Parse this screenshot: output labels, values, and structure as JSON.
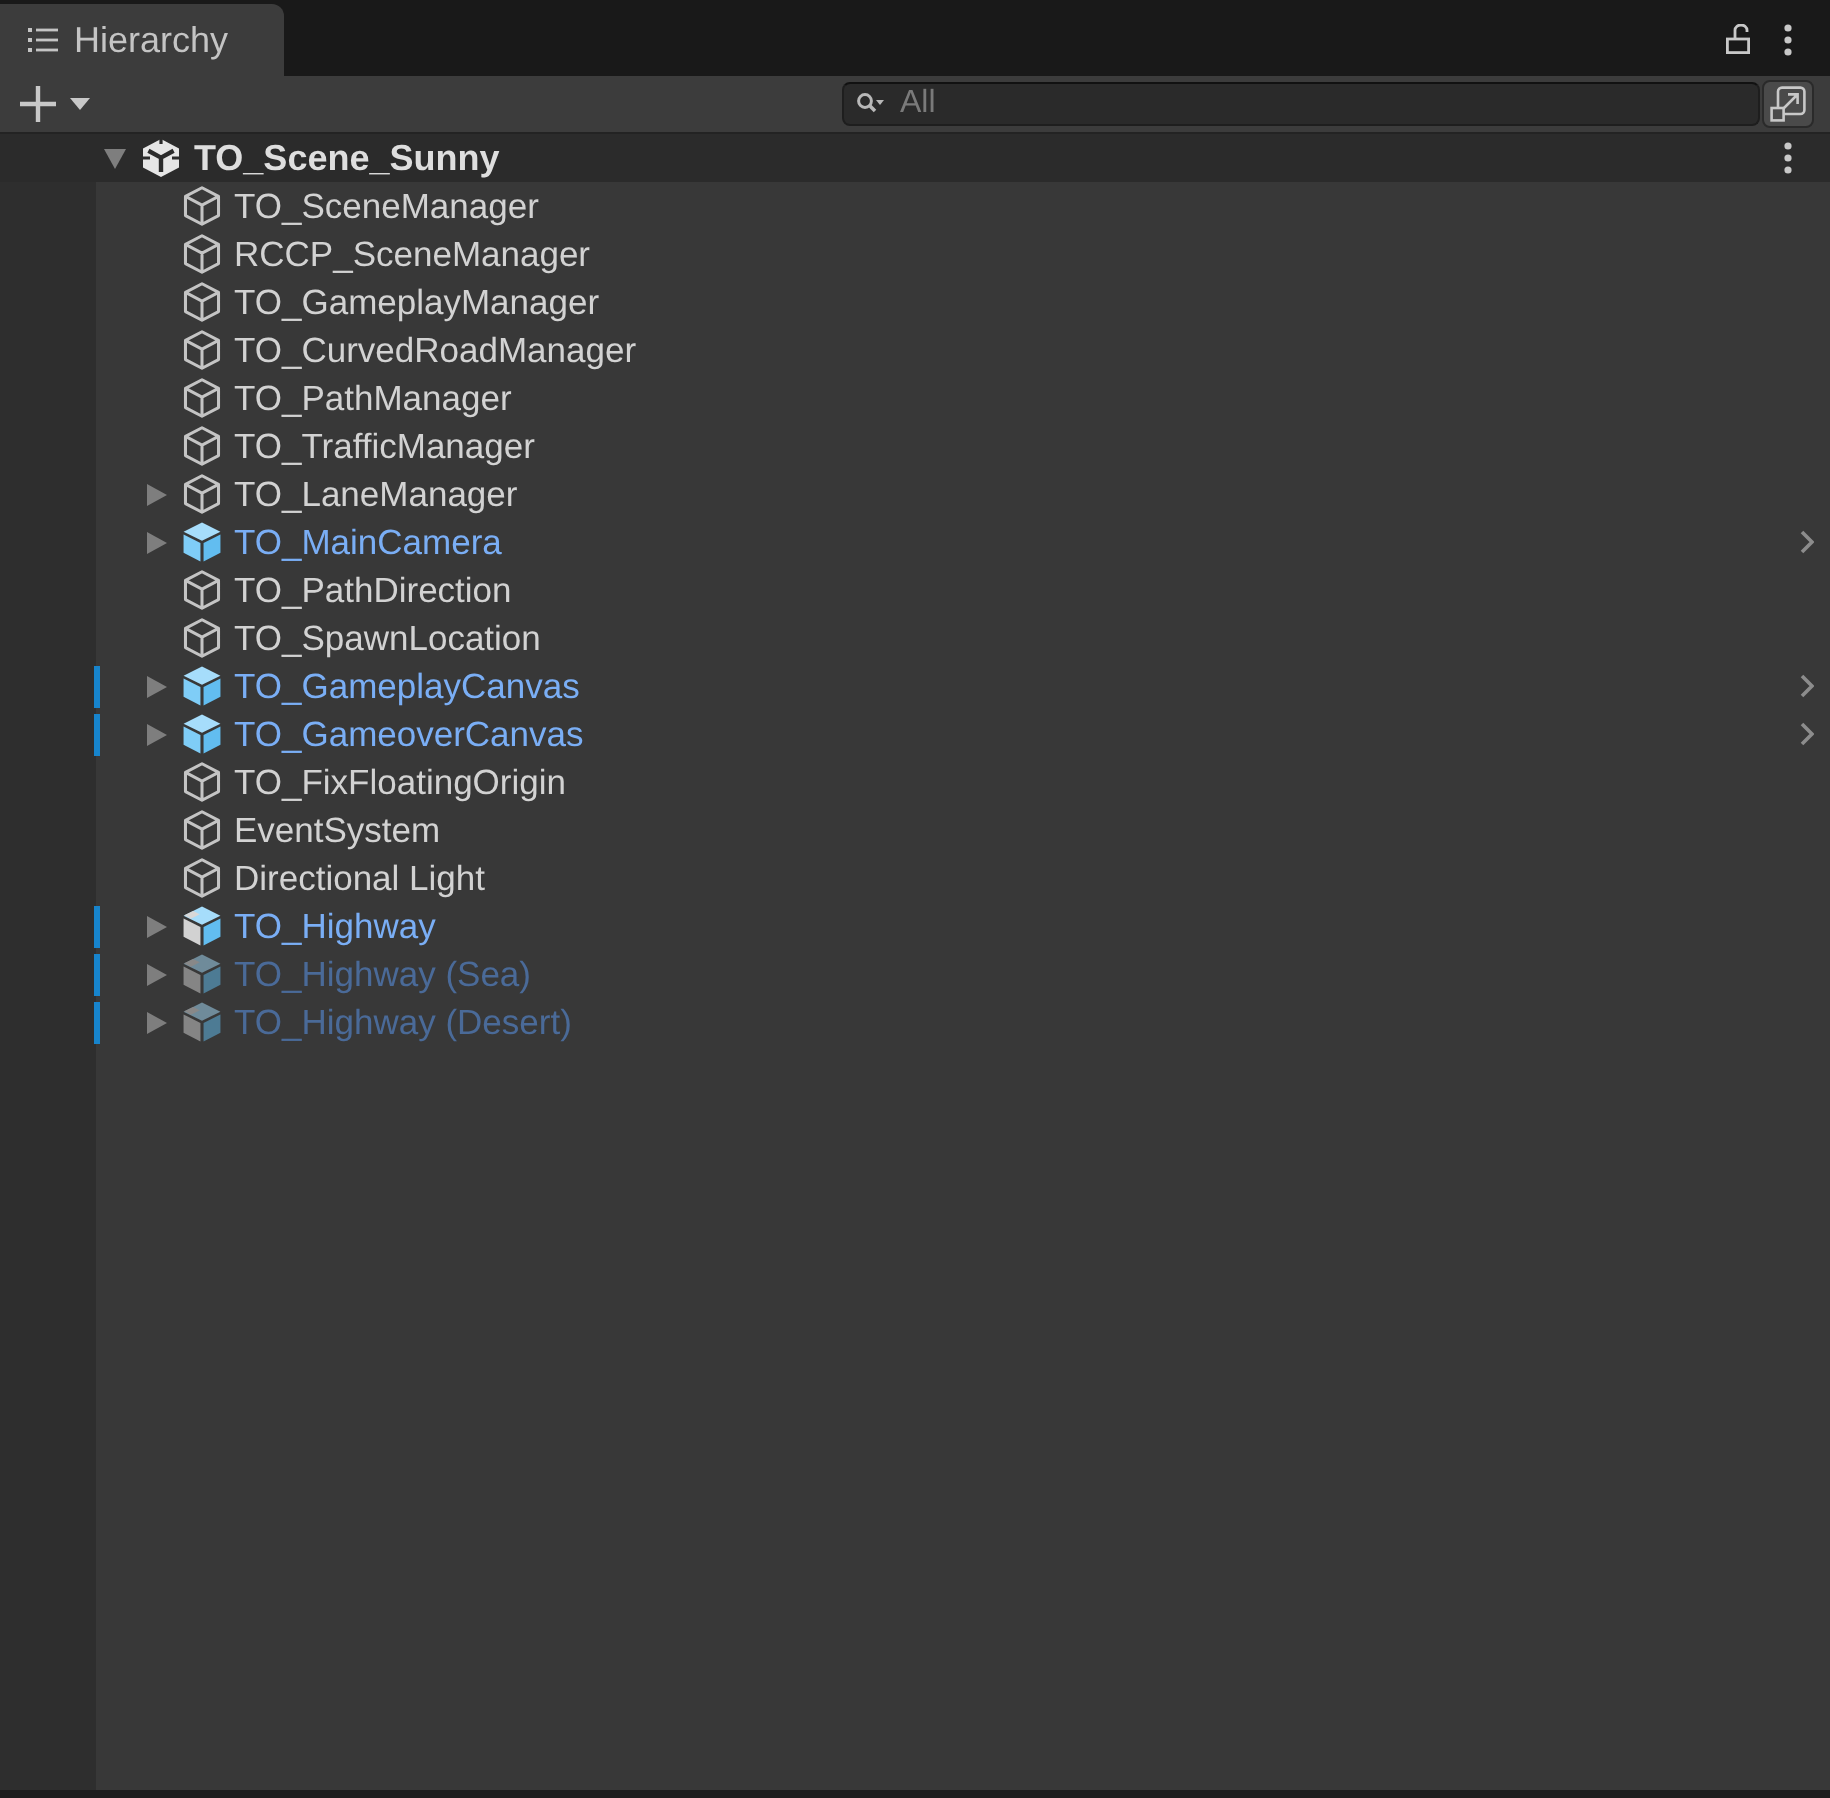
{
  "tab": {
    "label": "Hierarchy",
    "selected": true
  },
  "tab_bar": {
    "locked": false
  },
  "toolbar": {
    "search": {
      "placeholder": "All"
    }
  },
  "scene": {
    "name": "TO_Scene_Sunny",
    "expanded": true,
    "children": [
      {
        "name": "TO_SceneManager",
        "kind": "object",
        "has_children": false,
        "active": true,
        "overridden": false,
        "prefab_arrow": false
      },
      {
        "name": "RCCP_SceneManager",
        "kind": "object",
        "has_children": false,
        "active": true,
        "overridden": false,
        "prefab_arrow": false
      },
      {
        "name": "TO_GameplayManager",
        "kind": "object",
        "has_children": false,
        "active": true,
        "overridden": false,
        "prefab_arrow": false
      },
      {
        "name": "TO_CurvedRoadManager",
        "kind": "object",
        "has_children": false,
        "active": true,
        "overridden": false,
        "prefab_arrow": false
      },
      {
        "name": "TO_PathManager",
        "kind": "object",
        "has_children": false,
        "active": true,
        "overridden": false,
        "prefab_arrow": false
      },
      {
        "name": "TO_TrafficManager",
        "kind": "object",
        "has_children": false,
        "active": true,
        "overridden": false,
        "prefab_arrow": false
      },
      {
        "name": "TO_LaneManager",
        "kind": "object",
        "has_children": true,
        "expanded": false,
        "active": true,
        "overridden": false,
        "prefab_arrow": false
      },
      {
        "name": "TO_MainCamera",
        "kind": "prefab",
        "has_children": true,
        "expanded": false,
        "active": true,
        "overridden": false,
        "prefab_arrow": true
      },
      {
        "name": "TO_PathDirection",
        "kind": "object",
        "has_children": false,
        "active": true,
        "overridden": false,
        "prefab_arrow": false
      },
      {
        "name": "TO_SpawnLocation",
        "kind": "object",
        "has_children": false,
        "active": true,
        "overridden": false,
        "prefab_arrow": false
      },
      {
        "name": "TO_GameplayCanvas",
        "kind": "prefab",
        "has_children": true,
        "expanded": false,
        "active": true,
        "overridden": true,
        "prefab_arrow": true
      },
      {
        "name": "TO_GameoverCanvas",
        "kind": "prefab",
        "has_children": true,
        "expanded": false,
        "active": true,
        "overridden": true,
        "prefab_arrow": true
      },
      {
        "name": "TO_FixFloatingOrigin",
        "kind": "object",
        "has_children": false,
        "active": true,
        "overridden": false,
        "prefab_arrow": false
      },
      {
        "name": "EventSystem",
        "kind": "object",
        "has_children": false,
        "active": true,
        "overridden": false,
        "prefab_arrow": false
      },
      {
        "name": "Directional Light",
        "kind": "object",
        "has_children": false,
        "active": true,
        "overridden": false,
        "prefab_arrow": false
      },
      {
        "name": "TO_Highway",
        "kind": "model_prefab",
        "has_children": true,
        "expanded": false,
        "active": true,
        "overridden": true,
        "prefab_arrow": false
      },
      {
        "name": "TO_Highway (Sea)",
        "kind": "model_prefab",
        "has_children": true,
        "expanded": false,
        "active": false,
        "overridden": true,
        "prefab_arrow": false
      },
      {
        "name": "TO_Highway (Desert)",
        "kind": "model_prefab",
        "has_children": true,
        "expanded": false,
        "active": false,
        "overridden": true,
        "prefab_arrow": false
      }
    ]
  }
}
